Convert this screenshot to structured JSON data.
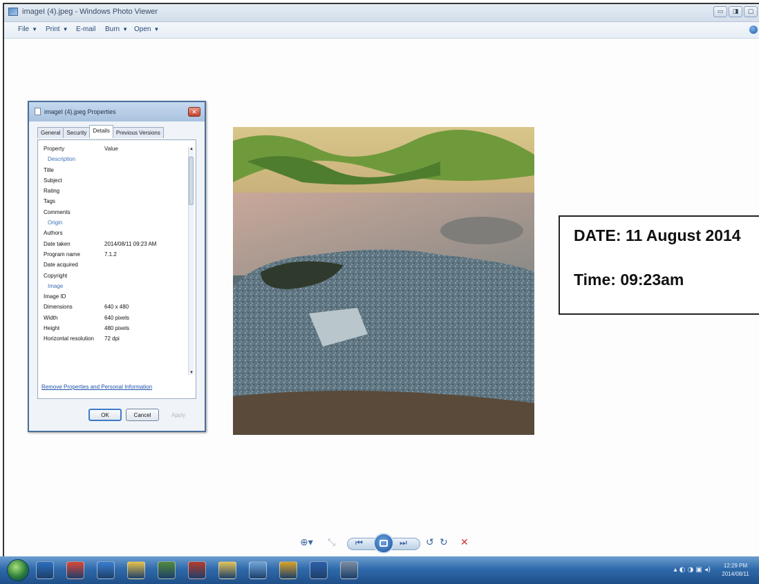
{
  "window": {
    "title": "imageI (4).jpeg - Windows Photo Viewer",
    "controls": [
      "▭",
      "◨",
      "▢"
    ]
  },
  "menubar": {
    "items": [
      {
        "label": "File"
      },
      {
        "label": "Print"
      },
      {
        "label": "E-mail"
      },
      {
        "label": "Burn"
      },
      {
        "label": "Open"
      }
    ]
  },
  "dialog": {
    "title": "imageI (4).jpeg Properties",
    "close": "✕",
    "tabs": [
      "General",
      "Security",
      "Details",
      "Previous Versions"
    ],
    "active_tab": "Details",
    "columns": {
      "property": "Property",
      "value": "Value"
    },
    "rows": [
      {
        "k": "Description",
        "v": "",
        "group": true
      },
      {
        "k": "Title",
        "v": ""
      },
      {
        "k": "Subject",
        "v": ""
      },
      {
        "k": "Rating",
        "v": ""
      },
      {
        "k": "Tags",
        "v": ""
      },
      {
        "k": "Comments",
        "v": ""
      },
      {
        "k": "Origin",
        "v": "",
        "group": true
      },
      {
        "k": "Authors",
        "v": ""
      },
      {
        "k": "Date taken",
        "v": "2014/08/11 09:23 AM"
      },
      {
        "k": "Program name",
        "v": "7.1.2"
      },
      {
        "k": "Date acquired",
        "v": ""
      },
      {
        "k": "Copyright",
        "v": ""
      },
      {
        "k": "Image",
        "v": "",
        "group": true
      },
      {
        "k": "Image ID",
        "v": ""
      },
      {
        "k": "Dimensions",
        "v": "640 x 480"
      },
      {
        "k": "Width",
        "v": "640 pixels"
      },
      {
        "k": "Height",
        "v": "480 pixels"
      },
      {
        "k": "Horizontal resolution",
        "v": "72 dpi"
      }
    ],
    "remove_link": "Remove Properties and Personal Information",
    "buttons": {
      "ok": "OK",
      "cancel": "Cancel",
      "apply": "Apply"
    }
  },
  "datebox": {
    "date": "DATE: 11 August 2014",
    "time": "Time: 09:23am"
  },
  "toolbar": {
    "zoom": "⊕▾",
    "fit": "⤡",
    "prev": "⏮",
    "next": "⏭",
    "rotate_ccw": "↺",
    "rotate_cw": "↻",
    "delete": "✕"
  },
  "taskbar": {
    "icon_colors": [
      "#2c6fc0",
      "#d9483a",
      "#3b7fd1",
      "#e8c24a",
      "#4f8a3c",
      "#b33b2e",
      "#e0c45a",
      "#6ea6da",
      "#d8a22a",
      "#2d5fa8",
      "#7a8ca0"
    ],
    "tray_icons": "▴ ◐ ◑ ▣ ◂)",
    "clock_time": "12:29 PM",
    "clock_date": "2014/08/11"
  }
}
